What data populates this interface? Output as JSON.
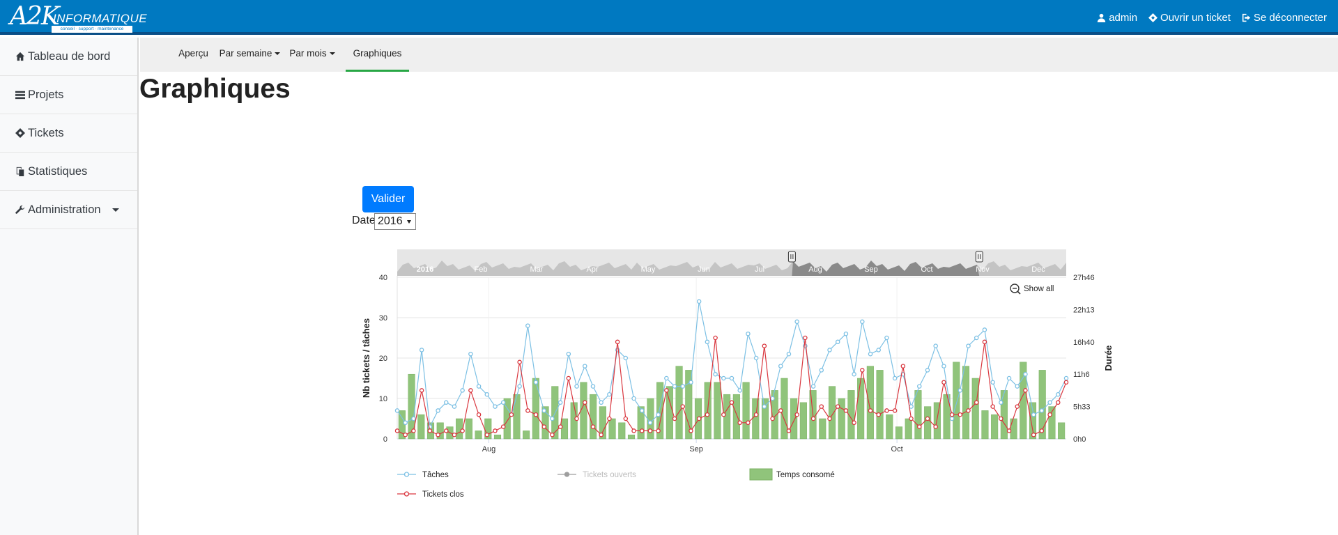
{
  "brand": {
    "big": "A2K",
    "small": "INFORMATIQUE",
    "tagline": "conseil · support · maintenance"
  },
  "topnav": {
    "admin": "admin",
    "open_ticket": "Ouvrir un ticket",
    "logout": "Se déconnecter"
  },
  "sidebar": {
    "items": [
      {
        "label": "Tableau de bord",
        "icon": "home-icon"
      },
      {
        "label": "Projets",
        "icon": "tasks-icon"
      },
      {
        "label": "Tickets",
        "icon": "ticket-icon"
      },
      {
        "label": "Statistiques",
        "icon": "copy-icon"
      },
      {
        "label": "Administration",
        "icon": "wrench-icon"
      }
    ]
  },
  "subnav": {
    "tabs": [
      {
        "label": "Aperçu"
      },
      {
        "label": "Par semaine"
      },
      {
        "label": "Par mois"
      },
      {
        "label": "Graphiques"
      }
    ],
    "active": "Graphiques"
  },
  "page": {
    "title": "Graphiques",
    "submit_label": "Valider",
    "date_label": "Date",
    "date_value": "2016"
  },
  "colors": {
    "accent": "#007bff",
    "topbar": "#0079c1",
    "taches": "#7cc0e4",
    "tickets_clos": "#d9363e",
    "tickets_ouverts": "#9e9e9e",
    "temps": "#90c47b",
    "active_tab": "#28a745"
  },
  "chart_data": {
    "type": "line",
    "navigator": {
      "months": [
        "2016",
        "Feb",
        "Mar",
        "Apr",
        "May",
        "Jun",
        "Jul",
        "Aug",
        "Sep",
        "Oct",
        "Nov",
        "Dec"
      ]
    },
    "zoom_button": "Show all",
    "y_left": {
      "label": "Nb tickets / tâches",
      "ticks": [
        "0",
        "10",
        "20",
        "30",
        "40"
      ],
      "range": [
        0,
        40
      ]
    },
    "y_right": {
      "label": "Durée",
      "ticks": [
        "0h0",
        "5h33",
        "11h6",
        "16h40",
        "22h13",
        "27h46"
      ]
    },
    "x_ticks": [
      "Aug",
      "Sep",
      "Oct"
    ],
    "series": [
      {
        "name": "Tâches",
        "kind": "line",
        "values": [
          7,
          4,
          5,
          22,
          3,
          7,
          9,
          8,
          12,
          21,
          13,
          11,
          8,
          9,
          6,
          13,
          28,
          14,
          7,
          5,
          9,
          21,
          13,
          18,
          13,
          9,
          11,
          22,
          20,
          10,
          7,
          4,
          6,
          15,
          13,
          13,
          14,
          34,
          24,
          16,
          15,
          15,
          12,
          26,
          20,
          8,
          10,
          18,
          21,
          29,
          23,
          13,
          17,
          22,
          24,
          26,
          16,
          29,
          21,
          22,
          25,
          15,
          16,
          8,
          13,
          17,
          23,
          18,
          5,
          12,
          23,
          25,
          27,
          14,
          9,
          15,
          13,
          16,
          6,
          7,
          9,
          11,
          15
        ]
      },
      {
        "name": "Tickets clos",
        "kind": "line",
        "values": [
          2,
          1,
          2,
          12,
          2,
          1,
          2,
          1,
          2,
          12,
          6,
          1,
          2,
          3,
          6,
          19,
          7,
          6,
          3,
          1,
          3,
          15,
          5,
          9,
          3,
          1,
          5,
          24,
          5,
          2,
          2,
          2,
          2,
          12,
          5,
          8,
          2,
          5,
          6,
          25,
          6,
          9,
          4,
          4,
          6,
          23,
          5,
          7,
          2,
          6,
          25,
          5,
          8,
          5,
          8,
          7,
          4,
          17,
          7,
          6,
          7,
          7,
          18,
          5,
          3,
          5,
          3,
          14,
          6,
          6,
          7,
          9,
          24,
          8,
          5,
          2,
          8,
          12,
          1,
          2,
          6,
          9,
          14
        ]
      },
      {
        "name": "Tickets ouverts",
        "kind": "line",
        "hidden": true,
        "values": []
      },
      {
        "name": "Temps consomé",
        "kind": "bar",
        "values": [
          7,
          16,
          6,
          4,
          4,
          3,
          5,
          5,
          2,
          5,
          1,
          10,
          11,
          2,
          15,
          8,
          13,
          5,
          9,
          14,
          11,
          8,
          5,
          4,
          1,
          8,
          10,
          14,
          13,
          18,
          17,
          10,
          14,
          14,
          11,
          11,
          14,
          10,
          10,
          12,
          15,
          10,
          9,
          12,
          5,
          13,
          10,
          12,
          15,
          18,
          17,
          6,
          3,
          5,
          12,
          8,
          9,
          11,
          19,
          18,
          15,
          7,
          6,
          12,
          5,
          19,
          9,
          17,
          8,
          4
        ]
      }
    ],
    "legend": [
      "Tâches",
      "Tickets ouverts",
      "Temps consomé",
      "Tickets clos"
    ]
  }
}
